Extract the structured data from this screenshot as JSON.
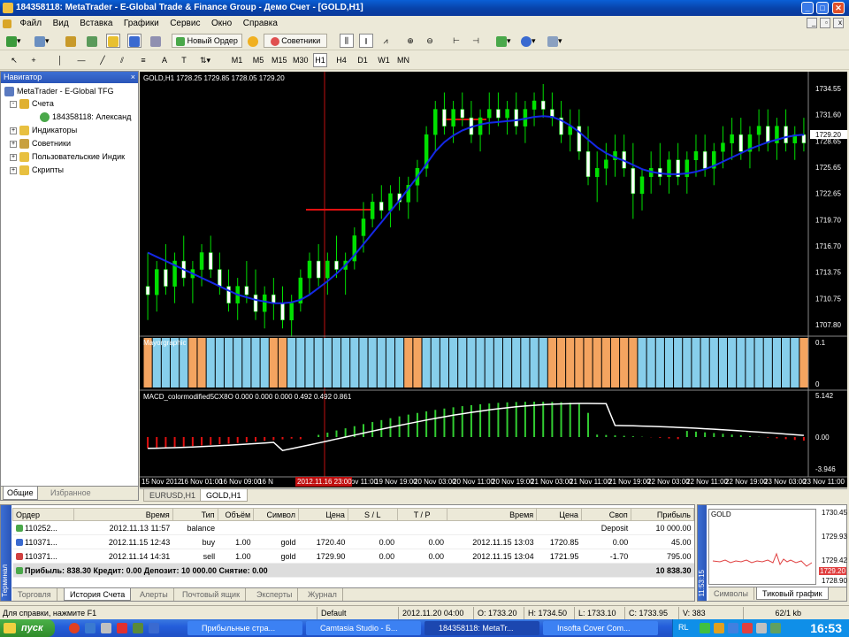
{
  "window": {
    "title": "184358118: MetaTrader - E-Global Trade & Finance Group - Демо Счет - [GOLD,H1]"
  },
  "menu": [
    "Файл",
    "Вид",
    "Вставка",
    "Графики",
    "Сервис",
    "Окно",
    "Справка"
  ],
  "toolbar": {
    "new_order": "Новый Ордер",
    "experts": "Советники",
    "timeframes": [
      "M1",
      "M5",
      "M15",
      "M30",
      "H1",
      "H4",
      "D1",
      "W1",
      "MN"
    ],
    "active_timeframe": "H1",
    "text_tool": "A"
  },
  "navigator": {
    "title": "Навигатор",
    "root": "MetaTrader - E-Global TFG",
    "items": [
      {
        "label": "Счета",
        "icon": "accounts-icon",
        "expander": "-"
      },
      {
        "label": "184358118: Александ",
        "icon": "user-icon",
        "expander": ""
      },
      {
        "label": "Индикаторы",
        "icon": "indicators-icon",
        "expander": "+"
      },
      {
        "label": "Советники",
        "icon": "experts-icon",
        "expander": "+"
      },
      {
        "label": "Пользовательские Индик",
        "icon": "custom-indicators-icon",
        "expander": "+"
      },
      {
        "label": "Скрипты",
        "icon": "scripts-icon",
        "expander": "+"
      }
    ],
    "tabs": [
      "Общие",
      "Избранное"
    ]
  },
  "chart": {
    "header": "GOLD,H1  1728.25 1729.85 1728.05 1729.20",
    "indicator1_header": "Mayorgraphic",
    "indicator2_header": "MACD_colormodified5CX8O 0.000 0.000 0.000 0.492 0.492 0.861",
    "price_ticks": [
      "1734.55",
      "1731.60",
      "1728.65",
      "1725.65",
      "1722.65",
      "1719.70",
      "1716.70",
      "1713.75",
      "1710.75",
      "1707.80"
    ],
    "current_price": "1729.20",
    "ind1_ticks": [
      "0.1",
      "0"
    ],
    "ind2_ticks": [
      "5.142",
      "0.00",
      "-3.946"
    ],
    "time_ticks": [
      "15 Nov 2012",
      "16 Nov 01:00",
      "16 Nov 09:00",
      "16 N",
      "20 Nov 03:00",
      "19 Nov 11:00",
      "19 Nov 19:00",
      "20 Nov 03:00",
      "20 Nov 11:00",
      "20 Nov 19:00",
      "21 Nov 03:00",
      "21 Nov 11:00",
      "21 Nov 19:00",
      "22 Nov 03:00",
      "22 Nov 11:00",
      "22 Nov 19:00",
      "23 Nov 03:00",
      "23 Nov 11:00"
    ],
    "crosshair_time": "2012.11.16 23:00",
    "tabs": [
      "EURUSD,H1",
      "GOLD,H1"
    ],
    "active_tab": "GOLD,H1",
    "colors": {
      "bull": "#00e000",
      "bear": "#ffffff",
      "ma": "#1428e6",
      "hist_blue": "#87ceeb",
      "hist_salmon": "#f4a460",
      "macd_pos": "#32cd32",
      "macd_neg": "#e01010"
    }
  },
  "chart_data": {
    "type": "candlestick",
    "title": "GOLD,H1",
    "ylim": [
      1706.5,
      1736.0
    ],
    "candles": [
      [
        1712,
        1716,
        1708,
        1711
      ],
      [
        1711,
        1715,
        1709,
        1714
      ],
      [
        1714,
        1717,
        1711,
        1712
      ],
      [
        1712,
        1716,
        1710,
        1715
      ],
      [
        1715,
        1718,
        1712,
        1713
      ],
      [
        1713,
        1715,
        1710,
        1714
      ],
      [
        1714,
        1717,
        1712,
        1716
      ],
      [
        1716,
        1718,
        1713,
        1714
      ],
      [
        1714,
        1716,
        1711,
        1712
      ],
      [
        1712,
        1714,
        1709,
        1710
      ],
      [
        1710,
        1713,
        1708,
        1712
      ],
      [
        1712,
        1715,
        1710,
        1711
      ],
      [
        1711,
        1714,
        1708,
        1709
      ],
      [
        1709,
        1712,
        1707,
        1711
      ],
      [
        1711,
        1713,
        1708,
        1710
      ],
      [
        1710,
        1712,
        1707,
        1708
      ],
      [
        1708,
        1711,
        1706,
        1710
      ],
      [
        1710,
        1714,
        1709,
        1713
      ],
      [
        1713,
        1716,
        1711,
        1715
      ],
      [
        1715,
        1717,
        1712,
        1713
      ],
      [
        1713,
        1716,
        1711,
        1715
      ],
      [
        1715,
        1718,
        1713,
        1714
      ],
      [
        1714,
        1716,
        1711,
        1715
      ],
      [
        1715,
        1719,
        1714,
        1718
      ],
      [
        1718,
        1722,
        1716,
        1720
      ],
      [
        1720,
        1723,
        1719,
        1722
      ],
      [
        1722,
        1724,
        1720,
        1721
      ],
      [
        1721,
        1724,
        1719,
        1723
      ],
      [
        1723,
        1725,
        1721,
        1722
      ],
      [
        1722,
        1725,
        1720,
        1724
      ],
      [
        1724,
        1727,
        1722,
        1726
      ],
      [
        1726,
        1731,
        1725,
        1730
      ],
      [
        1730,
        1734,
        1728,
        1733
      ],
      [
        1733,
        1735,
        1730,
        1731
      ],
      [
        1731,
        1734,
        1729,
        1733
      ],
      [
        1733,
        1735,
        1731,
        1732
      ],
      [
        1732,
        1734,
        1729,
        1730
      ],
      [
        1730,
        1733,
        1728,
        1732
      ],
      [
        1732,
        1735,
        1730,
        1733
      ],
      [
        1733,
        1735,
        1731,
        1732
      ],
      [
        1732,
        1734,
        1730,
        1733
      ],
      [
        1733,
        1735,
        1730,
        1731
      ],
      [
        1731,
        1734,
        1729,
        1733
      ],
      [
        1733,
        1735,
        1731,
        1734
      ],
      [
        1734,
        1736,
        1732,
        1733
      ],
      [
        1733,
        1735,
        1731,
        1732
      ],
      [
        1732,
        1734,
        1729,
        1730
      ],
      [
        1730,
        1733,
        1728,
        1731
      ],
      [
        1731,
        1733,
        1727,
        1728
      ],
      [
        1728,
        1731,
        1724,
        1725
      ],
      [
        1725,
        1728,
        1722,
        1726
      ],
      [
        1726,
        1729,
        1724,
        1727
      ],
      [
        1727,
        1730,
        1725,
        1728
      ],
      [
        1728,
        1730,
        1725,
        1726
      ],
      [
        1726,
        1729,
        1720,
        1723
      ],
      [
        1723,
        1726,
        1721,
        1725
      ],
      [
        1725,
        1728,
        1723,
        1726
      ],
      [
        1726,
        1729,
        1724,
        1725
      ],
      [
        1725,
        1728,
        1723,
        1727
      ],
      [
        1727,
        1729,
        1724,
        1725
      ],
      [
        1725,
        1728,
        1723,
        1727
      ],
      [
        1727,
        1730,
        1725,
        1728
      ],
      [
        1728,
        1730,
        1725,
        1726
      ],
      [
        1726,
        1729,
        1724,
        1728
      ],
      [
        1728,
        1731,
        1726,
        1729
      ],
      [
        1729,
        1732,
        1727,
        1730
      ],
      [
        1730,
        1732,
        1727,
        1728
      ],
      [
        1728,
        1731,
        1726,
        1730
      ],
      [
        1730,
        1733,
        1728,
        1731
      ],
      [
        1731,
        1733,
        1728,
        1729
      ],
      [
        1729,
        1732,
        1727,
        1731
      ],
      [
        1731,
        1733,
        1728,
        1729
      ],
      [
        1729,
        1731,
        1727,
        1730
      ],
      [
        1730,
        1732,
        1728,
        1729
      ]
    ],
    "ma": [
      1716,
      1715.5,
      1715,
      1714.5,
      1714,
      1713.5,
      1713,
      1712.5,
      1712,
      1711.5,
      1711,
      1710.7,
      1710.4,
      1710.2,
      1710,
      1710,
      1710.1,
      1710.4,
      1711,
      1711.8,
      1712.6,
      1713.5,
      1714.5,
      1715.7,
      1717,
      1718.3,
      1719.6,
      1720.9,
      1722.2,
      1723.6,
      1725,
      1726.5,
      1728,
      1729.1,
      1729.9,
      1730.5,
      1730.9,
      1731.2,
      1731.4,
      1731.5,
      1731.6,
      1731.7,
      1731.9,
      1732.1,
      1732.2,
      1732.1,
      1731.7,
      1731.1,
      1730.3,
      1729.4,
      1728.5,
      1727.8,
      1727.3,
      1726.9,
      1726.4,
      1725.9,
      1725.6,
      1725.4,
      1725.3,
      1725.3,
      1725.4,
      1725.6,
      1725.9,
      1726.3,
      1726.8,
      1727.3,
      1727.8,
      1728.3,
      1728.7,
      1729.1,
      1729.4,
      1729.7,
      1729.9,
      1730.0
    ]
  },
  "terminal": {
    "columns": [
      "Ордер",
      "Время",
      "Тип",
      "Объём",
      "Символ",
      "Цена",
      "S / L",
      "T / P",
      "Время",
      "Цена",
      "Своп",
      "Прибыль"
    ],
    "rows": [
      {
        "order": "110252...",
        "time": "2012.11.13 11:57",
        "type": "balance",
        "volume": "",
        "symbol": "",
        "price": "",
        "sl": "",
        "tp": "",
        "ctime": "",
        "cprice": "",
        "swap": "Deposit",
        "profit": "10 000.00"
      },
      {
        "order": "110371...",
        "time": "2012.11.15 12:43",
        "type": "buy",
        "volume": "1.00",
        "symbol": "gold",
        "price": "1720.40",
        "sl": "0.00",
        "tp": "0.00",
        "ctime": "2012.11.15 13:03",
        "cprice": "1720.85",
        "swap": "0.00",
        "profit": "45.00"
      },
      {
        "order": "110371...",
        "time": "2012.11.14 14:31",
        "type": "sell",
        "volume": "1.00",
        "symbol": "gold",
        "price": "1729.90",
        "sl": "0.00",
        "tp": "0.00",
        "ctime": "2012.11.15 13:04",
        "cprice": "1721.95",
        "swap": "-1.70",
        "profit": "795.00"
      }
    ],
    "total": {
      "text": "Прибыль: 838.30  Кредит: 0.00  Депозит: 10 000.00  Снятие: 0.00",
      "profit": "10 838.30"
    },
    "tabs": [
      "Торговля",
      "История Счета",
      "Алерты",
      "Почтовый ящик",
      "Эксперты",
      "Журнал"
    ],
    "active_tab": "История Счета",
    "side_label": "Терминал"
  },
  "tick_chart": {
    "symbol": "GOLD",
    "ticks": [
      "1730.45",
      "1729.93",
      "1729.42",
      "1729.20",
      "1728.90"
    ],
    "current": "1729.20",
    "side_label": "11:53:15",
    "tabs": [
      "Символы",
      "Тиковый график"
    ],
    "active_tab": "Тиковый график"
  },
  "status": {
    "help": "Для справки, нажмите F1",
    "profile": "Default",
    "datetime": "2012.11.20 04:00",
    "open": "O: 1733.20",
    "high": "H: 1734.50",
    "low": "L: 1733.10",
    "close": "C: 1733.95",
    "volume": "V: 383",
    "traffic": "62/1 kb"
  },
  "taskbar": {
    "start": "пуск",
    "tasks": [
      "Прибыльные стра...",
      "Camtasia Studio - Б...",
      "184358118: MetaTr...",
      "Insofta Cover Com..."
    ],
    "lang": "RL",
    "clock": "16:53"
  }
}
